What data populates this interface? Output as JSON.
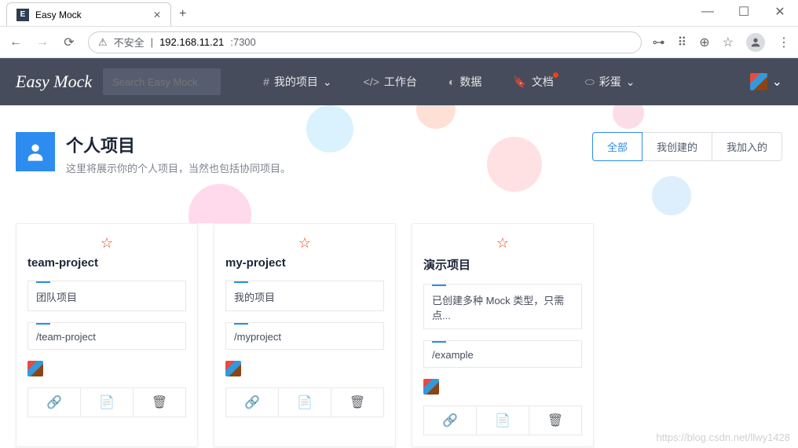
{
  "browser": {
    "tab_title": "Easy Mock",
    "tab_favicon_letter": "E",
    "url_insecure_label": "不安全",
    "url_host": "192.168.11.21",
    "url_port": ":7300"
  },
  "header": {
    "logo": "Easy Mock",
    "search_placeholder": "Search Easy Mock",
    "menu": {
      "projects": "我的项目",
      "workspace": "工作台",
      "data": "数据",
      "docs": "文档",
      "egg": "彩蛋"
    }
  },
  "hero": {
    "title": "个人项目",
    "subtitle": "这里将展示你的个人项目，当然也包括协同项目。",
    "tabs": {
      "all": "全部",
      "created": "我创建的",
      "joined": "我加入的"
    }
  },
  "projects": [
    {
      "name": "team-project",
      "desc": "团队项目",
      "path": "/team-project"
    },
    {
      "name": "my-project",
      "desc": "我的项目",
      "path": "/myproject"
    },
    {
      "name": "演示项目",
      "desc": "已创建多种 Mock 类型，只需点...",
      "path": "/example"
    }
  ],
  "watermark": "https://blog.csdn.net/llwy1428"
}
